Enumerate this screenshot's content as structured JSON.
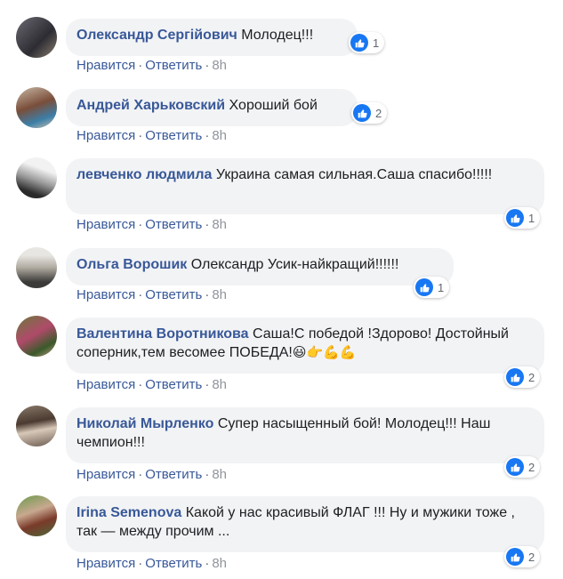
{
  "actions": {
    "like": "Нравится",
    "reply": "Ответить",
    "sep": "·"
  },
  "colors": {
    "author": "#385898",
    "bubble": "#f2f3f5",
    "like": "#1877f2"
  },
  "comments": [
    {
      "author": "Олександр Сергійович",
      "text": "Молодец!!!",
      "time": "8h",
      "likes": "1"
    },
    {
      "author": "Андрей Харьковский",
      "text": "Хороший бой",
      "time": "8h",
      "likes": "2"
    },
    {
      "author": "левченко людмила",
      "text": "Украина самая сильная.Саша спасибо!!!!!",
      "time": "8h",
      "likes": "1"
    },
    {
      "author": "Ольга Ворошик",
      "text": "Олександр Усик-найкращий!!!!!!",
      "time": "8h",
      "likes": "1"
    },
    {
      "author": "Валентина Воротникова",
      "text": "Саша!С победой !Здорово! Достойный соперник,тем весомее ПОБЕДА!",
      "emoji": "😃👉💪💪",
      "time": "8h",
      "likes": "2"
    },
    {
      "author": "Николай Мырленко",
      "text": "Супер насыщенный бой! Молодец!!! Наш чемпион!!!",
      "time": "8h",
      "likes": "2"
    },
    {
      "author": "Irina Semenova",
      "text": "Какой у нас красивый ФЛАГ !!! Ну и мужики тоже , так — между прочим ...",
      "time": "8h",
      "likes": "2"
    }
  ]
}
